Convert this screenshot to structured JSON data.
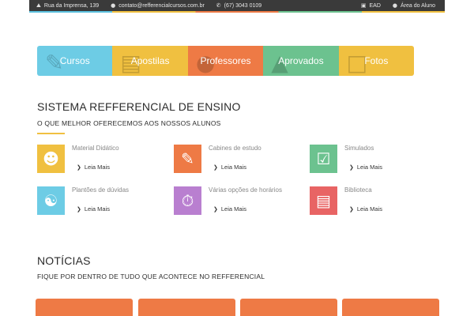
{
  "topbar": {
    "address": "Rua da Imprensa, 139",
    "email": "contato@refferencialcursos.com.br",
    "phone": "(67) 3043 0109",
    "ead": "EAD",
    "student_area": "Área do Aluno"
  },
  "tabs": [
    {
      "label": "Cursos",
      "color": "#6dcce5",
      "icon": "graduation-icon"
    },
    {
      "label": "Apostilas",
      "color": "#f0c040",
      "icon": "book-icon"
    },
    {
      "label": "Professores",
      "color": "#ee7a45",
      "icon": "teacher-icon"
    },
    {
      "label": "Aprovados",
      "color": "#6cc28f",
      "icon": "cap-icon"
    },
    {
      "label": "Fotos",
      "color": "#f0c040",
      "icon": "photo-icon"
    }
  ],
  "section1": {
    "title": "SISTEMA REFFERENCIAL DE ENSINO",
    "subtitle": "O QUE MELHOR OFERECEMOS AOS NOSSOS ALUNOS"
  },
  "features": [
    {
      "title": "Material Didático",
      "more": "Leia Mais",
      "color": "#f0c040",
      "icon": "group-icon"
    },
    {
      "title": "Cabines de estudo",
      "more": "Leia Mais",
      "color": "#ee7a45",
      "icon": "pencil-icon"
    },
    {
      "title": "Simulados",
      "more": "Leia Mais",
      "color": "#6cc28f",
      "icon": "checkbox-icon"
    },
    {
      "title": "Plantões de dúvidas",
      "more": "Leia Mais",
      "color": "#6dcce5",
      "icon": "chat-icon"
    },
    {
      "title": "Várias opções de horários",
      "more": "Leia Mais",
      "color": "#b97fd0",
      "icon": "stopwatch-icon"
    },
    {
      "title": "Biblioteca",
      "more": "Leia Mais",
      "color": "#e86464",
      "icon": "book-icon"
    }
  ],
  "section2": {
    "title": "NOTÍCIAS",
    "subtitle": "FIQUE POR DENTRO DE TUDO QUE ACONTECE NO REFFERENCIAL"
  },
  "colors": {
    "accent_yellow": "#f0c040",
    "accent_orange": "#ee7a45",
    "topbar": "#3a3a3a"
  }
}
